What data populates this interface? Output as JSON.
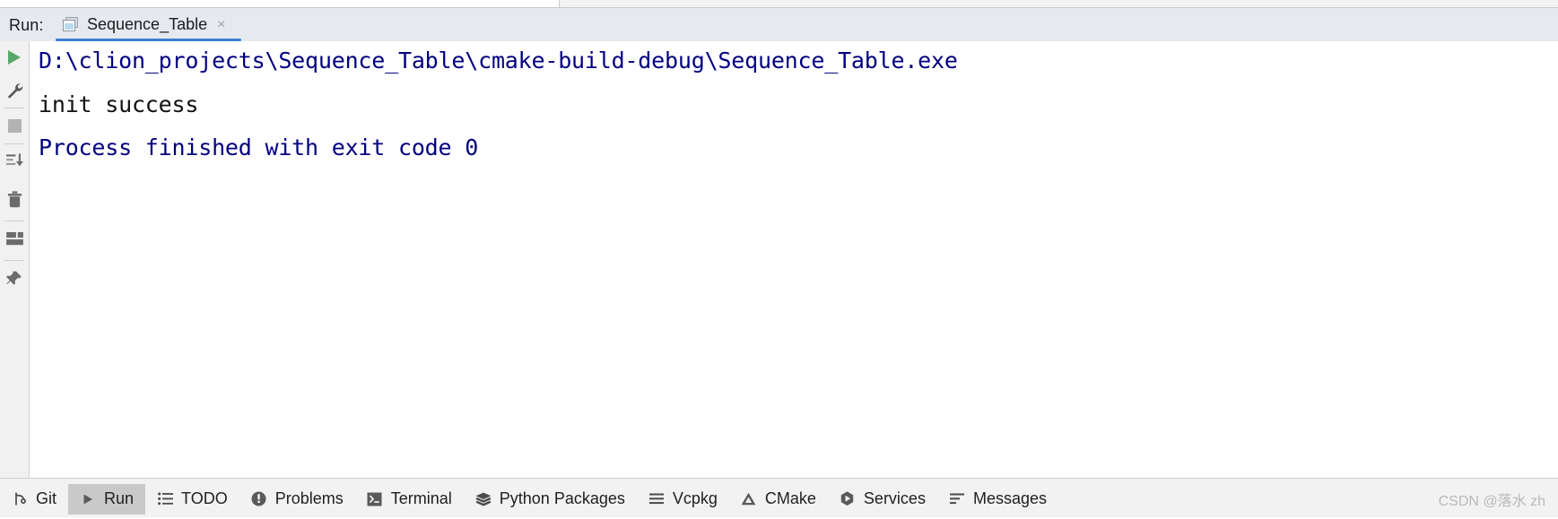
{
  "run_panel": {
    "label": "Run:",
    "tab": {
      "icon": "run-configuration-icon",
      "title": "Sequence_Table",
      "close": "×"
    }
  },
  "side_toolbar": {
    "buttons": [
      {
        "name": "rerun-button",
        "icon": "play-icon",
        "tooltip": "Rerun"
      },
      {
        "name": "debug-settings-button",
        "icon": "wrench-icon",
        "tooltip": "Modify Run Configuration"
      },
      {
        "name": "stop-button",
        "icon": "stop-square-icon",
        "tooltip": "Stop"
      },
      {
        "name": "scroll-to-end-button",
        "icon": "scroll-to-end-icon",
        "tooltip": "Scroll to End"
      },
      {
        "name": "clear-all-button",
        "icon": "trash-icon",
        "tooltip": "Clear All"
      },
      {
        "name": "layout-settings-button",
        "icon": "layout-icon",
        "tooltip": "Layout Settings"
      },
      {
        "name": "pin-tab-button",
        "icon": "pin-icon",
        "tooltip": "Pin Tab"
      }
    ]
  },
  "console": {
    "lines": [
      {
        "text": "D:\\clion_projects\\Sequence_Table\\cmake-build-debug\\Sequence_Table.exe",
        "color": "#000080"
      },
      {
        "text": "init success",
        "color": "#111111"
      },
      {
        "text": "Process finished with exit code 0",
        "color": "#000080"
      }
    ]
  },
  "status_bar": {
    "items": [
      {
        "label": "Git",
        "icon": "git-branch-icon",
        "active": false
      },
      {
        "label": "Run",
        "icon": "play-icon",
        "active": true
      },
      {
        "label": "TODO",
        "icon": "todo-list-icon",
        "active": false
      },
      {
        "label": "Problems",
        "icon": "problems-icon",
        "active": false
      },
      {
        "label": "Terminal",
        "icon": "terminal-icon",
        "active": false
      },
      {
        "label": "Python Packages",
        "icon": "layers-icon",
        "active": false
      },
      {
        "label": "Vcpkg",
        "icon": "hamburger-lines-icon",
        "active": false
      },
      {
        "label": "CMake",
        "icon": "triangle-icon",
        "active": false
      },
      {
        "label": "Services",
        "icon": "services-play-icon",
        "active": false
      },
      {
        "label": "Messages",
        "icon": "messages-lines-icon",
        "active": false
      }
    ],
    "watermark": "CSDN @落水 zh"
  },
  "colors": {
    "accent_blue": "#3d7fd1",
    "console_blue": "#000080",
    "run_header_bg": "#e6e9f0",
    "status_bg": "#f2f2f2",
    "toolbar_bg": "#f1f1f1",
    "run_green": "#59a869"
  }
}
